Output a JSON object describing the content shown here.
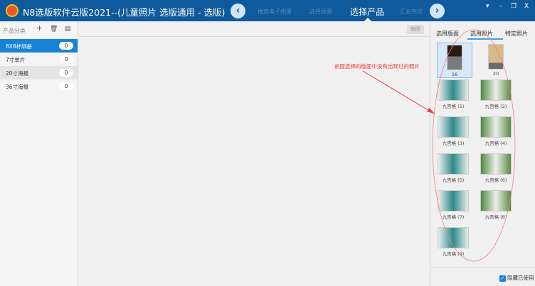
{
  "window": {
    "title": "N8选版软件云版2021--(儿童照片 选版通用 - 选版)",
    "controls": [
      "▾",
      "–",
      "❐",
      "X"
    ]
  },
  "steps": [
    {
      "label": "播放电子相册"
    },
    {
      "label": "选择版面"
    },
    {
      "label": "选择产品"
    },
    {
      "label": "汇总完成"
    }
  ],
  "nav": {
    "prev": "‹",
    "next": "›"
  },
  "sidebar": {
    "header": "产品分类",
    "add": "+",
    "delete": "🗑",
    "edit": "▤",
    "items": [
      {
        "label": "8X8杯绑册",
        "count": "0"
      },
      {
        "label": "7寸单片",
        "count": "0"
      },
      {
        "label": "20寸海报",
        "count": "0"
      },
      {
        "label": "36寸海报",
        "count": "0"
      }
    ]
  },
  "main": {
    "delete_label": "删除"
  },
  "right": {
    "tabs": [
      "选用版面",
      "选用照片",
      "特定照片"
    ],
    "thumbs": [
      {
        "label": "16"
      },
      {
        "label": "20"
      },
      {
        "label": "九宫格 (1)"
      },
      {
        "label": "九宫格 (2)"
      },
      {
        "label": "九宫格 (3)"
      },
      {
        "label": "九宫格 (4)"
      },
      {
        "label": "九宫格 (5)"
      },
      {
        "label": "九宫格 (6)"
      },
      {
        "label": "九宫格 (7)"
      },
      {
        "label": "九宫格 (8)"
      },
      {
        "label": "九宫格 (9)"
      }
    ],
    "hide_used": "隐藏已使用",
    "hide_used_checked": true
  },
  "annotation": "前面选择的版面中没有出现过的照片"
}
